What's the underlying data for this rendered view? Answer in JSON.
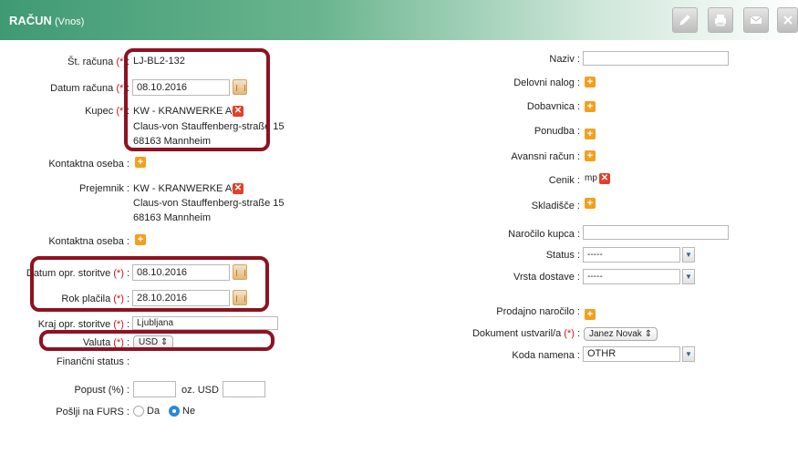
{
  "header": {
    "title": "RAČUN",
    "subtitle": "(Vnos)"
  },
  "toolbar": {
    "icons": [
      "pencil-icon",
      "printer-icon",
      "envelope-icon",
      "close-icon"
    ]
  },
  "required_mark": "(*)",
  "colon": ":",
  "left": {
    "st_racuna": {
      "label": "Št. računa",
      "value": "LJ-BL2-132"
    },
    "datum_racuna": {
      "label": "Datum računa",
      "value": "08.10.2016"
    },
    "kupec": {
      "label": "Kupec",
      "name": "KW - KRANWERKE AG",
      "street": "Claus-von Stauffenberg-straße 15",
      "city": "68163 Mannheim"
    },
    "kontaktna_oseba_1": {
      "label": "Kontaktna oseba :"
    },
    "prejemnik": {
      "label": "Prejemnik :",
      "name": "KW - KRANWERKE AG",
      "street": "Claus-von Stauffenberg-straße 15",
      "city": "68163 Mannheim"
    },
    "kontaktna_oseba_2": {
      "label": "Kontaktna oseba :"
    },
    "datum_opr_storitve": {
      "label": "Datum opr. storitve",
      "value": "08.10.2016"
    },
    "rok_placila": {
      "label": "Rok plačila",
      "value": "28.10.2016"
    },
    "kraj_opr_storitve": {
      "label": "Kraj opr. storitve",
      "value": "Ljubljana"
    },
    "valuta": {
      "label": "Valuta",
      "value": "USD"
    },
    "financni_status": {
      "label": "Finančni status :"
    },
    "popust": {
      "label": "Popust (%) :",
      "oz_label": "oz. USD :",
      "percent_value": "",
      "amount_value": ""
    },
    "poslji_na_furs": {
      "label": "Pošlji na FURS :",
      "options": [
        "Da",
        "Ne"
      ],
      "selected": "Ne"
    }
  },
  "right": {
    "naziv": {
      "label": "Naziv :",
      "value": ""
    },
    "delovni_nalog": {
      "label": "Delovni nalog :"
    },
    "dobavnica": {
      "label": "Dobavnica :"
    },
    "ponudba": {
      "label": "Ponudba :"
    },
    "avansni_racun": {
      "label": "Avansni račun :"
    },
    "cenik": {
      "label": "Cenik :",
      "value": "mp"
    },
    "skladisce": {
      "label": "Skladišče :"
    },
    "narocilo_kupca": {
      "label": "Naročilo kupca :",
      "value": ""
    },
    "status": {
      "label": "Status :",
      "value": "-----"
    },
    "vrsta_dostave": {
      "label": "Vrsta dostave :",
      "value": "-----"
    },
    "prodajno_narocilo": {
      "label": "Prodajno naročilo :"
    },
    "dokument_ustvaril": {
      "label": "Dokument ustvaril/a",
      "value": "Janez Novak"
    },
    "koda_namena": {
      "label": "Koda namena :",
      "value": "OTHR"
    }
  }
}
